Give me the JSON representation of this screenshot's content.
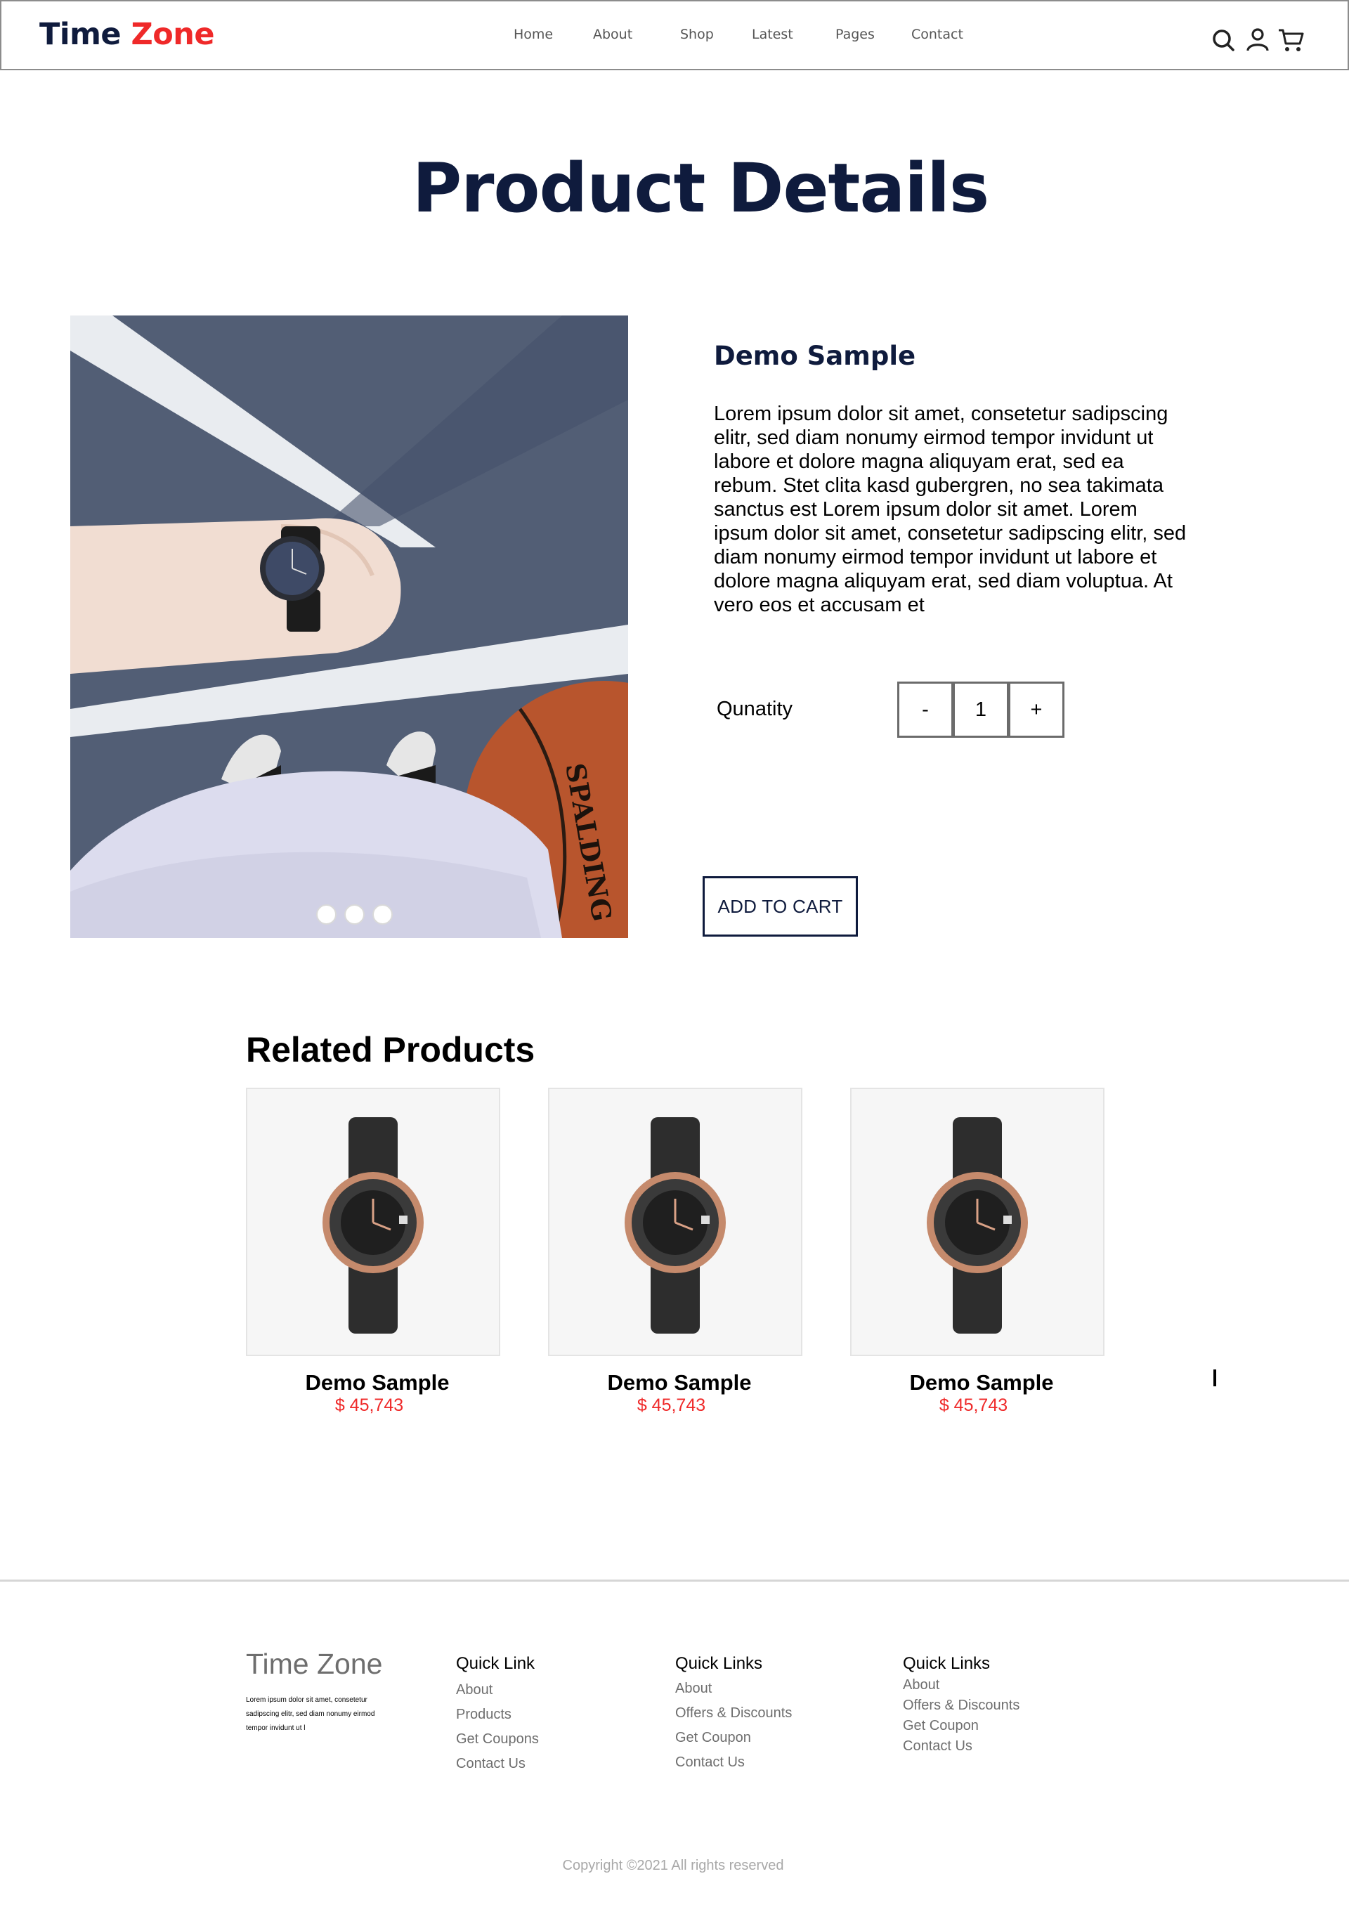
{
  "header": {
    "logo_primary": "Time",
    "logo_accent": "Zone",
    "nav": [
      "Home",
      "About",
      "Shop",
      "Latest",
      "Pages",
      "Contact"
    ]
  },
  "icons": [
    "search-icon",
    "user-icon",
    "cart-icon"
  ],
  "page_title": "Product Details",
  "product": {
    "name": "Demo Sample",
    "description": "Lorem ipsum dolor sit amet, consetetur sadipscing elitr, sed diam nonumy eirmod tempor invidunt ut labore et dolore magna aliquyam erat, sed ea rebum. Stet clita kasd gubergren, no sea takimata sanctus est Lorem ipsum dolor sit amet. Lorem ipsum dolor sit amet, consetetur sadipscing elitr, sed diam nonumy eirmod tempor invidunt ut labore et dolore magna aliquyam erat, sed diam voluptua. At vero eos et accusam et",
    "quantity_label": "Qunatity",
    "decrement": "-",
    "quantity": "1",
    "increment": "+",
    "add_to_cart": "ADD TO CART",
    "image_brand_text": "SPALDING"
  },
  "related": {
    "title": "Related Products",
    "items": [
      {
        "name": "Demo Sample",
        "price": "$ 45,743"
      },
      {
        "name": "Demo Sample",
        "price": "$ 45,743"
      },
      {
        "name": "Demo Sample",
        "price": "$ 45,743"
      }
    ]
  },
  "footer": {
    "brand": "Time Zone",
    "brand_text": "Lorem ipsum dolor sit amet, consetetur sadipscing elitr, sed diam nonumy eirmod tempor invidunt ut l",
    "columns": [
      {
        "heading": "Quick Link",
        "links": [
          "About",
          "Products",
          "Get Coupons",
          "Contact Us"
        ]
      },
      {
        "heading": "Quick Links",
        "links": [
          "About",
          "Offers & Discounts",
          "Get Coupon",
          "Contact Us"
        ]
      },
      {
        "heading": "Quick Links",
        "links": [
          "About",
          "Offers & Discounts",
          "Get Coupon",
          "Contact Us"
        ]
      }
    ],
    "copyright": "Copyright ©2021 All rights reserved"
  },
  "colors": {
    "navy": "#0f1b3d",
    "accent_red": "#ef2929",
    "muted_gray": "#6e6e6e"
  }
}
